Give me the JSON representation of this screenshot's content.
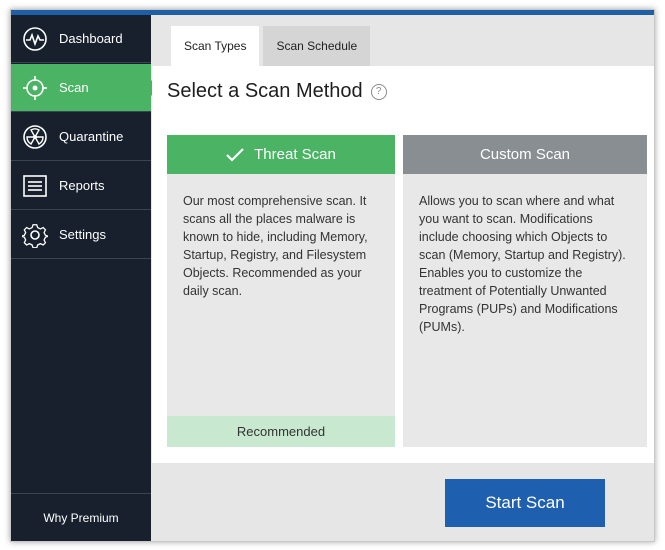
{
  "sidebar": {
    "items": [
      {
        "label": "Dashboard",
        "icon": "pulse-icon"
      },
      {
        "label": "Scan",
        "icon": "crosshair-icon"
      },
      {
        "label": "Quarantine",
        "icon": "radiation-icon"
      },
      {
        "label": "Reports",
        "icon": "list-icon"
      },
      {
        "label": "Settings",
        "icon": "gear-icon"
      }
    ],
    "active_index": 1,
    "why_premium": "Why Premium"
  },
  "tabs": [
    {
      "label": "Scan Types"
    },
    {
      "label": "Scan Schedule"
    }
  ],
  "main": {
    "title": "Select a Scan Method",
    "help_glyph": "?"
  },
  "threat_scan": {
    "label": "Threat Scan",
    "description": "Our most comprehensive scan. It scans all the places malware is known to hide, including Memory, Startup, Registry, and Filesystem Objects. Recommended as your daily scan.",
    "footer": "Recommended"
  },
  "custom_scan": {
    "label": "Custom Scan",
    "description": "Allows you to scan where and what you want to scan. Modifications include choosing which Objects to scan (Memory, Startup and Registry). Enables you to customize the treatment of Potentially Unwanted Programs (PUPs) and Modifications (PUMs)."
  },
  "actions": {
    "start_scan": "Start Scan"
  },
  "colors": {
    "sidebar_bg": "#17202c",
    "accent_green": "#4ab364",
    "recommended_bg": "#c9e8d0",
    "custom_gray": "#898e93",
    "primary_blue": "#1f5fb0"
  }
}
